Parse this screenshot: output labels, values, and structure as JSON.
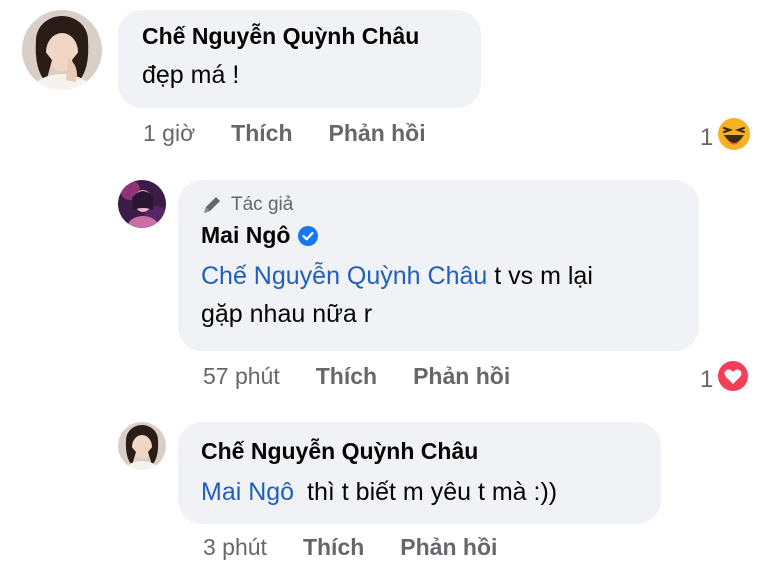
{
  "colors": {
    "bubble": "#f0f2f5",
    "mention": "#1f5fbf",
    "meta_text": "#65676b",
    "verified": "#1877f2",
    "love": "#f33e58",
    "haha": "#f7b125"
  },
  "comments": [
    {
      "author": "Chế Nguyễn Quỳnh Châu",
      "text": "đẹp má !",
      "time": "1 giờ",
      "like_label": "Thích",
      "reply_label": "Phản hồi",
      "reaction_count": "1",
      "reaction_icon": "haha-emoji-icon"
    },
    {
      "author_badge": "Tác giả",
      "author": "Mai Ngô",
      "verified_icon": "verified-badge-icon",
      "mention": "Chế Nguyễn Quỳnh Châu",
      "text_line1": "t vs m lại",
      "text_line2": "gặp nhau nữa r",
      "time": "57 phút",
      "like_label": "Thích",
      "reply_label": "Phản hồi",
      "reaction_count": "1",
      "reaction_icon": "love-heart-icon"
    },
    {
      "author": "Chế Nguyễn Quỳnh Châu",
      "mention": "Mai Ngô",
      "text": "thì t biết m yêu t mà :))",
      "time": "3 phút",
      "like_label": "Thích",
      "reply_label": "Phản hồi"
    }
  ]
}
